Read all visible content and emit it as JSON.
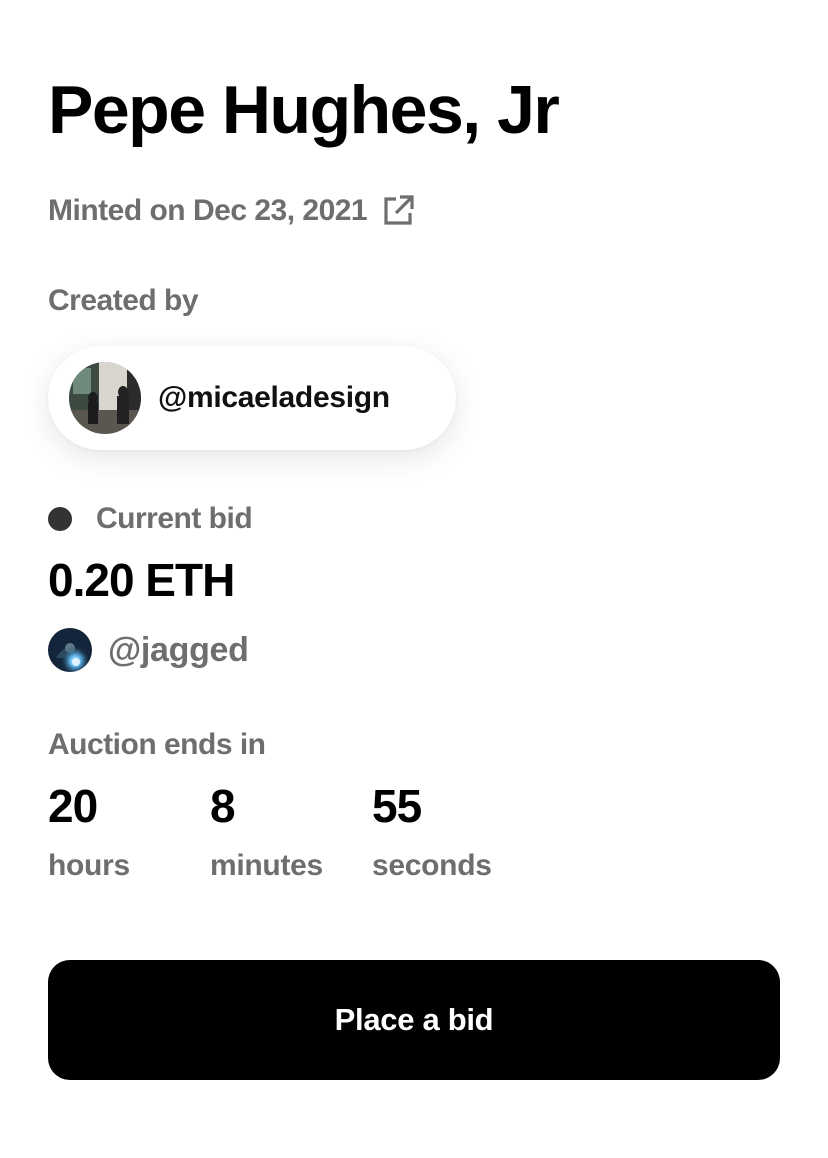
{
  "artwork": {
    "title": "Pepe Hughes, Jr",
    "minted": "Minted on Dec 23, 2021",
    "external_link_icon": "external-link-icon"
  },
  "creator": {
    "label": "Created by",
    "handle": "@micaeladesign",
    "avatar_icon": "creator-avatar"
  },
  "bid": {
    "label": "Current bid",
    "status_dot_color": "#333333",
    "amount": "0.20 ETH",
    "bidder_handle": "@jagged",
    "bidder_avatar_icon": "bidder-avatar"
  },
  "auction": {
    "label": "Auction ends in",
    "countdown": [
      {
        "value": "20",
        "label": "hours"
      },
      {
        "value": "8",
        "label": "minutes"
      },
      {
        "value": "55",
        "label": "seconds"
      }
    ]
  },
  "actions": {
    "place_bid_label": "Place a bid"
  },
  "colors": {
    "primary_text": "#000000",
    "secondary_text": "#6e6e6e",
    "button_background": "#000000",
    "button_text": "#ffffff"
  }
}
